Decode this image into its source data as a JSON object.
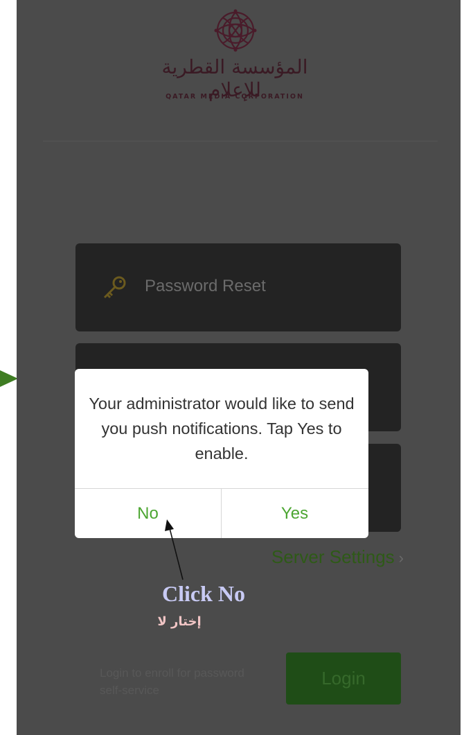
{
  "colors": {
    "background": "#4b4b4b",
    "field": "#232323",
    "accent_green": "#4ca632",
    "login_button": "#1f4d17",
    "brand_maroon": "#3a1a24",
    "annotation_arrow": "#3f7d23"
  },
  "logo": {
    "arabic": "المؤسسة القطرية للإعلام",
    "english": "QATAR MEDIA CORPORATION",
    "emblem_icon": "ornament-emblem-icon"
  },
  "fields": [
    {
      "icon": "key-icon",
      "label": "Password Reset"
    }
  ],
  "server_settings": {
    "label": "Server Settings",
    "icon": "chevron-right-icon",
    "glyph": "›"
  },
  "enroll": {
    "text": "Login to enroll for password self-service"
  },
  "login": {
    "label": "Login"
  },
  "dialog": {
    "message": "Your administrator would like to send you push notifications. Tap Yes to enable.",
    "no_label": "No",
    "yes_label": "Yes"
  },
  "annotation": {
    "english": "Click No",
    "arabic": "إختار لا",
    "pointer_icon": "arrow-pointer-icon",
    "side_arrow_icon": "triangle-right-icon"
  }
}
